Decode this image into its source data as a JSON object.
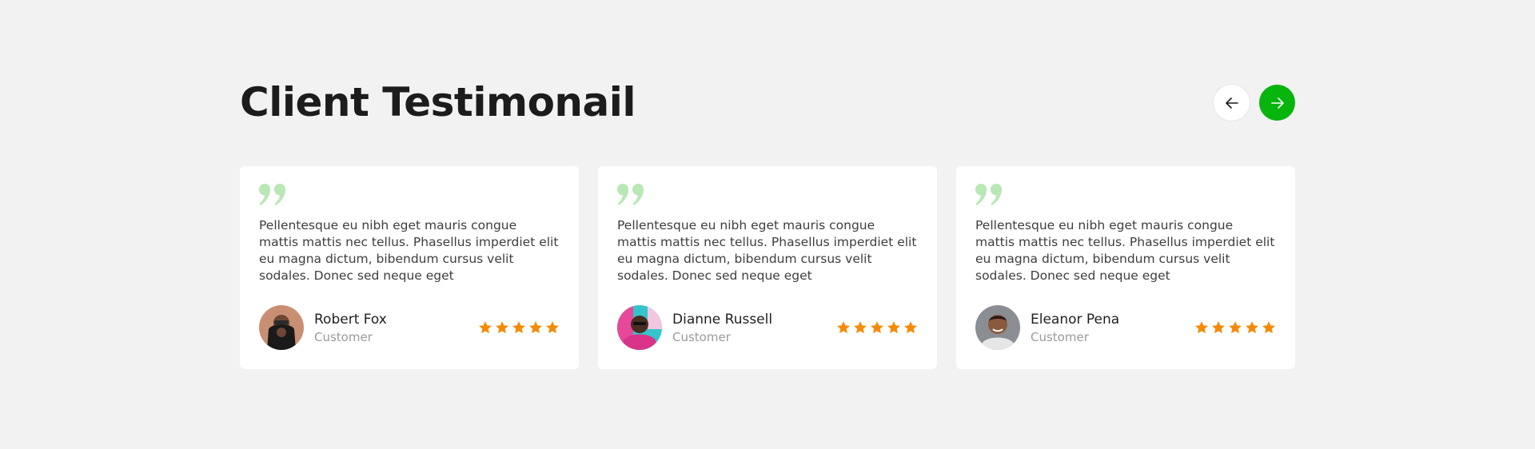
{
  "section": {
    "heading": "Client Testimonail",
    "nav": {
      "prev_icon": "arrow-left-icon",
      "next_icon": "arrow-right-icon"
    }
  },
  "colors": {
    "background": "#f2f2f2",
    "card": "#ffffff",
    "accent": "#08b40e",
    "quote": "#b9e7b6",
    "star": "#f58a07"
  },
  "testimonials": [
    {
      "text": "Pellentesque eu nibh eget mauris congue mattis mattis nec tellus. Phasellus imperdiet elit eu magna dictum, bibendum cursus velit sodales. Donec sed neque eget",
      "name": "Robert Fox",
      "role": "Customer",
      "rating": 5
    },
    {
      "text": "Pellentesque eu nibh eget mauris congue mattis mattis nec tellus. Phasellus imperdiet elit eu magna dictum, bibendum cursus velit sodales. Donec sed neque eget",
      "name": "Dianne Russell",
      "role": "Customer",
      "rating": 5
    },
    {
      "text": "Pellentesque eu nibh eget mauris congue mattis mattis nec tellus. Phasellus imperdiet elit eu magna dictum, bibendum cursus velit sodales. Donec sed neque eget",
      "name": "Eleanor Pena",
      "role": "Customer",
      "rating": 5
    }
  ]
}
